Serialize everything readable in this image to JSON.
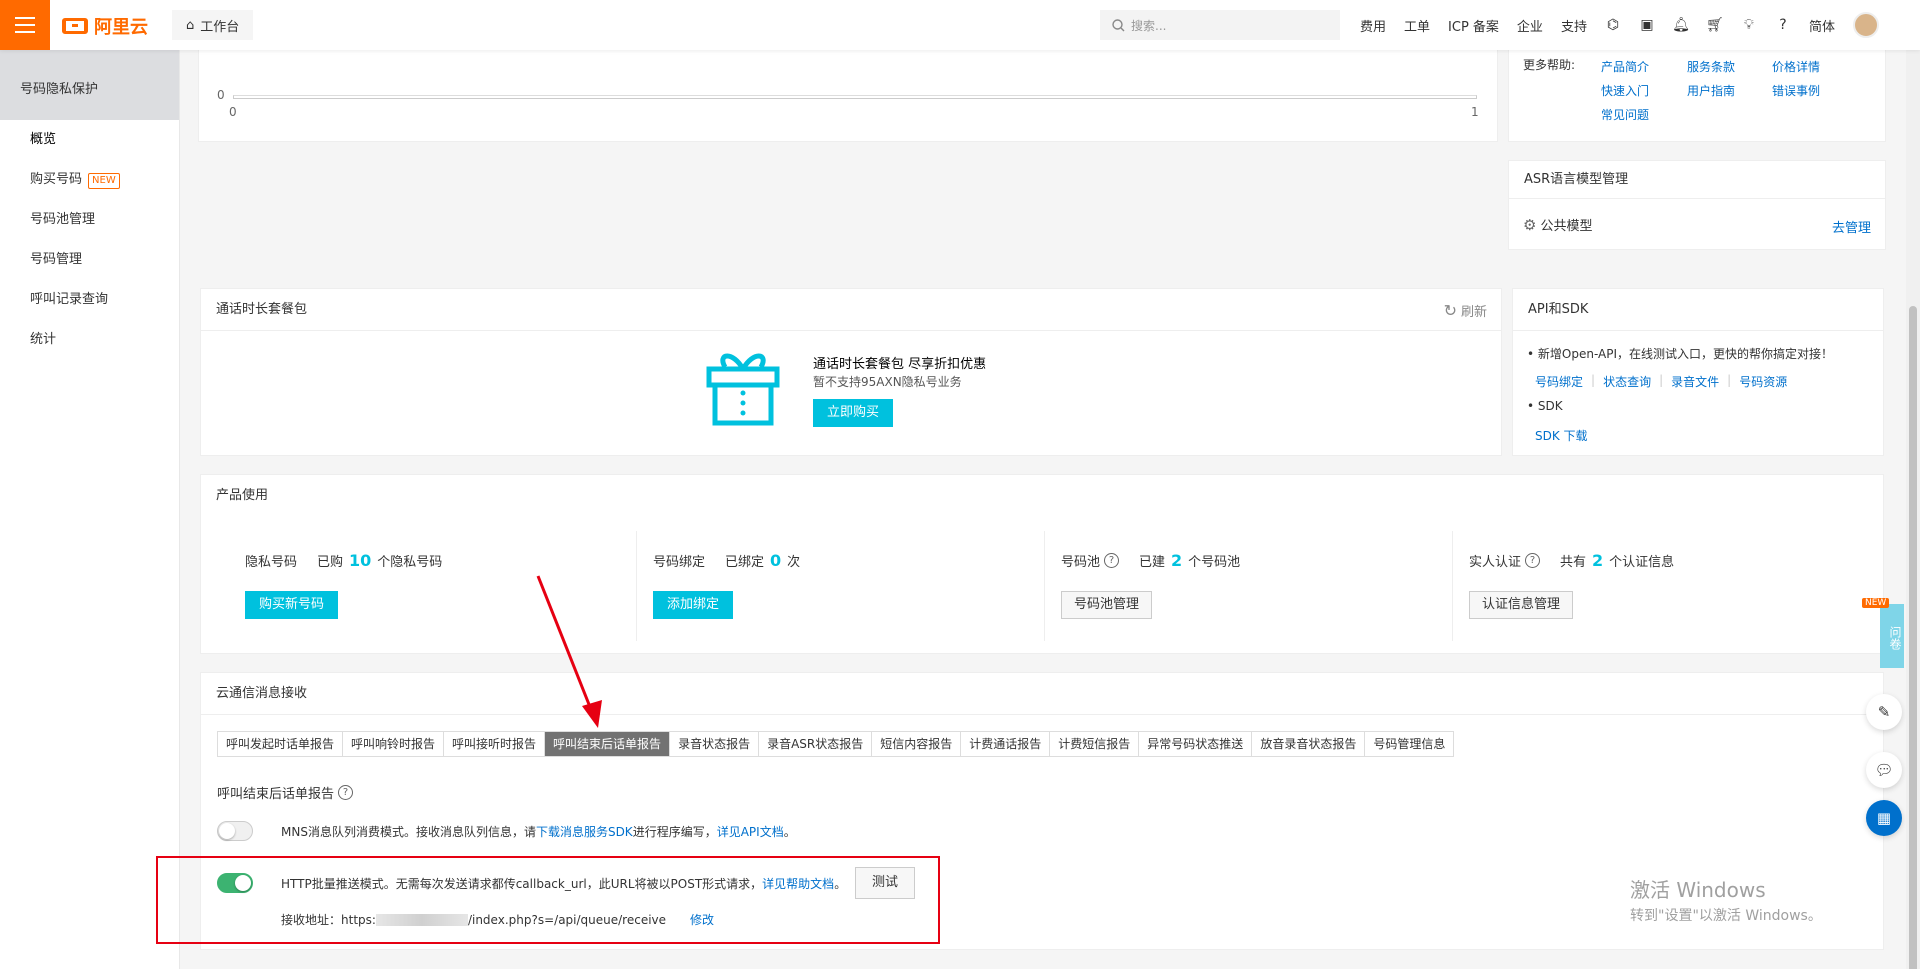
{
  "topbar": {
    "logo_text": "阿里云",
    "workbench": "工作台",
    "search_placeholder": "搜索...",
    "nav": [
      "费用",
      "工单",
      "ICP 备案",
      "企业",
      "支持"
    ],
    "lang": "简体"
  },
  "sidebar": {
    "title": "号码隐私保护",
    "items": [
      {
        "label": "概览"
      },
      {
        "label": "购买号码",
        "badge": "NEW"
      },
      {
        "label": "号码池管理"
      },
      {
        "label": "号码管理"
      },
      {
        "label": "呼叫记录查询"
      },
      {
        "label": "统计"
      }
    ]
  },
  "chart": {
    "y0": "0",
    "x0": "0",
    "x1": "1"
  },
  "help": {
    "label": "更多帮助:",
    "links": [
      "产品简介",
      "服务条款",
      "价格详情",
      "快速入门",
      "用户指南",
      "错误事例",
      "常见问题"
    ]
  },
  "asr": {
    "title": "ASR语言模型管理",
    "item": "公共模型",
    "manage": "去管理"
  },
  "package": {
    "title": "通话时长套餐包",
    "refresh": "刷新",
    "headline": "通话时长套餐包 尽享折扣优惠",
    "sub": "暂不支持95AXN隐私号业务",
    "buy": "立即购买"
  },
  "api": {
    "title": "API和SDK",
    "line1": "• 新增Open-API，在线测试入口，更快的帮你搞定对接！",
    "links": [
      "号码绑定",
      "状态查询",
      "录音文件",
      "号码资源"
    ],
    "sdk": "• SDK",
    "sdk_download": "SDK 下载"
  },
  "usage": {
    "title": "产品使用",
    "cards": [
      {
        "name": "隐私号码",
        "pre": "已购",
        "num": "10",
        "unit": "个隐私号码",
        "btn": "购买新号码",
        "primary": true
      },
      {
        "name": "号码绑定",
        "pre": "已绑定",
        "num": "0",
        "unit": "次",
        "btn": "添加绑定",
        "primary": true
      },
      {
        "name": "号码池",
        "pre": "已建",
        "num": "2",
        "unit": "个号码池",
        "btn": "号码池管理",
        "primary": false,
        "help": "?"
      },
      {
        "name": "实人认证",
        "pre": "共有",
        "num": "2",
        "unit": "个认证信息",
        "btn": "认证信息管理",
        "primary": false,
        "help": "?"
      }
    ]
  },
  "msg": {
    "title": "云通信消息接收",
    "tabs": [
      "呼叫发起时话单报告",
      "呼叫响铃时报告",
      "呼叫接听时报告",
      "呼叫结束后话单报告",
      "录音状态报告",
      "录音ASR状态报告",
      "短信内容报告",
      "计费通话报告",
      "计费短信报告",
      "异常号码状态推送",
      "放音录音状态报告",
      "号码管理信息"
    ],
    "section_title": "呼叫结束后话单报告",
    "mns_text": "MNS消息队列消费模式。接收消息队列信息，请",
    "mns_link1": "下载消息服务SDK",
    "mns_mid": "进行程序编写，",
    "mns_link2": "详见API文档",
    "mns_end": "。",
    "http_text": "HTTP批量推送模式。无需每次发送请求都传callback_url，此URL将被以POST形式请求，",
    "http_link": "详见帮助文档",
    "http_end": "。",
    "test_btn": "测试",
    "addr_label": "接收地址：",
    "addr_prefix": "https:",
    "addr_suffix": "/index.php?s=/api/queue/receive",
    "modify": "修改"
  },
  "watermark": {
    "line1": "激活 Windows",
    "line2": "转到\"设置\"以激活 Windows。"
  },
  "survey": {
    "badge": "NEW",
    "text": "问卷"
  }
}
